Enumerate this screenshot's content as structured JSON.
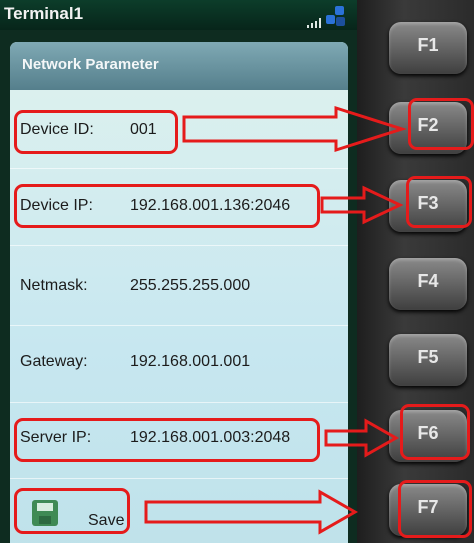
{
  "statusbar": {
    "title": "Terminal1"
  },
  "panel": {
    "title": "Network Parameter"
  },
  "fields": [
    {
      "label": "Device ID:",
      "value": "001"
    },
    {
      "label": "Device IP:",
      "value": "192.168.001.136:2046"
    },
    {
      "label": "Netmask:",
      "value": "255.255.255.000"
    },
    {
      "label": "Gateway:",
      "value": "192.168.001.001"
    },
    {
      "label": "Server IP:",
      "value": "192.168.001.003:2048"
    }
  ],
  "save": {
    "label": "Save",
    "icon": "floppy-disk-icon"
  },
  "keys": [
    "F1",
    "F2",
    "F3",
    "F4",
    "F5",
    "F6",
    "F7"
  ],
  "annotation_color": "#e51b1b"
}
